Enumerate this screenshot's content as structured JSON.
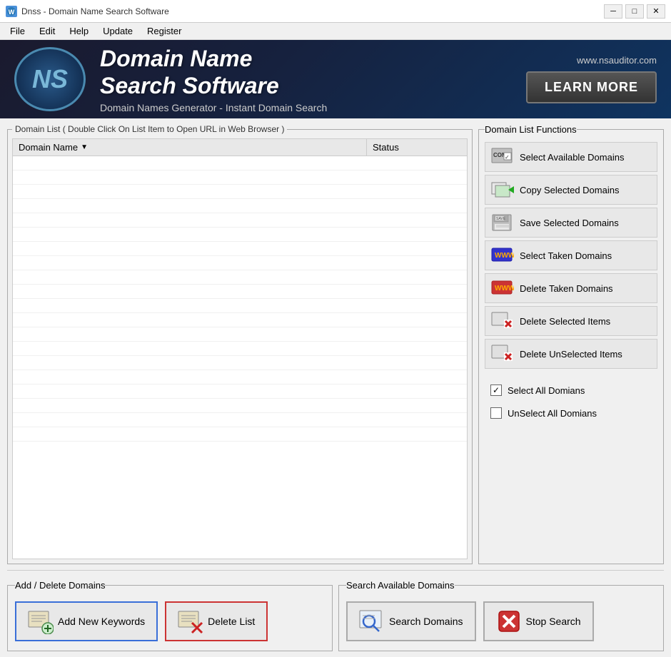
{
  "window": {
    "title": "Dnss - Domain Name Search Software",
    "icon": "NS"
  },
  "menu": {
    "items": [
      "File",
      "Edit",
      "Help",
      "Update",
      "Register"
    ]
  },
  "banner": {
    "logo_text": "NS",
    "title_line1": "Domain Name",
    "title_line2": "Search Software",
    "subtitle": "Domain Names Generator - Instant Domain Search",
    "url": "www.nsauditor.com",
    "learn_more": "LEARN MORE"
  },
  "domain_list": {
    "panel_title": "Domain List ( Double Click On List Item to Open URL in Web Browser )",
    "col_domain": "Domain Name",
    "col_status": "Status",
    "rows": []
  },
  "functions": {
    "panel_title": "Domain List Functions",
    "buttons": [
      {
        "id": "select-available",
        "label": "Select Available Domains",
        "icon_type": "com"
      },
      {
        "id": "copy-selected",
        "label": "Copy Selected Domains",
        "icon_type": "arrow-right"
      },
      {
        "id": "save-selected",
        "label": "Save Selected Domains",
        "icon_type": "save"
      },
      {
        "id": "select-taken",
        "label": "Select Taken Domains",
        "icon_type": "www-green"
      },
      {
        "id": "delete-taken",
        "label": "Delete Taken Domains",
        "icon_type": "www-red"
      },
      {
        "id": "delete-selected",
        "label": "Delete Selected Items",
        "icon_type": "delete-x"
      },
      {
        "id": "delete-unselected",
        "label": "Delete UnSelected Items",
        "icon_type": "delete-x2"
      }
    ],
    "checkboxes": [
      {
        "id": "select-all",
        "label": "Select All Domians",
        "checked": true
      },
      {
        "id": "unselect-all",
        "label": "UnSelect All Domians",
        "checked": false
      }
    ]
  },
  "add_delete": {
    "panel_title": "Add / Delete Domains",
    "add_btn": "Add New Keywords",
    "delete_btn": "Delete List"
  },
  "search": {
    "panel_title": "Search Available Domains",
    "search_btn": "Search Domains",
    "stop_btn": "Stop Search"
  }
}
